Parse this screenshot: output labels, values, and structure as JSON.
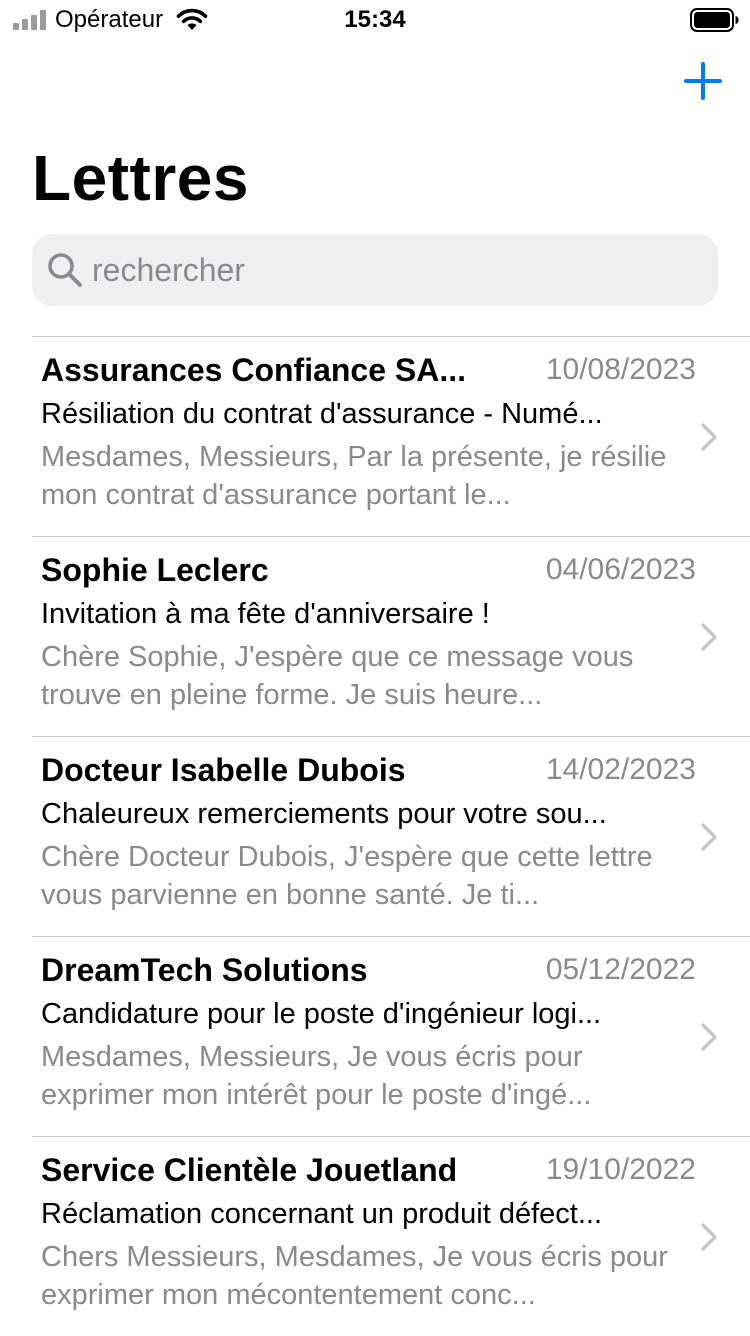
{
  "status_bar": {
    "carrier": "Opérateur",
    "time": "15:34"
  },
  "nav": {
    "add_icon": "plus-icon",
    "title": "Lettres"
  },
  "search": {
    "placeholder": "rechercher",
    "icon": "search-icon"
  },
  "letters": [
    {
      "sender": "Assurances Confiance SA...",
      "date": "10/08/2023",
      "subject": "Résiliation du contrat d'assurance - Numé...",
      "preview": "Mesdames, Messieurs,  Par la présente, je résilie mon contrat d'assurance portant le..."
    },
    {
      "sender": "Sophie Leclerc",
      "date": "04/06/2023",
      "subject": "Invitation à ma fête d'anniversaire !",
      "preview": "Chère Sophie,  J'espère que ce message vous trouve en pleine forme. Je suis heure..."
    },
    {
      "sender": "Docteur Isabelle Dubois",
      "date": "14/02/2023",
      "subject": "Chaleureux remerciements pour votre sou...",
      "preview": "Chère Docteur Dubois,  J'espère que cette lettre vous parvienne en bonne santé. Je ti..."
    },
    {
      "sender": "DreamTech Solutions",
      "date": "05/12/2022",
      "subject": "Candidature pour le poste d'ingénieur logi...",
      "preview": "Mesdames, Messieurs,  Je vous écris pour exprimer mon intérêt pour le poste d'ingé..."
    },
    {
      "sender": "Service Clientèle Jouetland",
      "date": "19/10/2022",
      "subject": "Réclamation concernant un produit défect...",
      "preview": "Chers Messieurs, Mesdames,  Je vous écris pour exprimer mon mécontentement conc..."
    }
  ],
  "colors": {
    "accent": "#007aff",
    "secondary_text": "#8a8a8e",
    "search_background": "#efeff0",
    "separator": "#c8c8cc"
  }
}
